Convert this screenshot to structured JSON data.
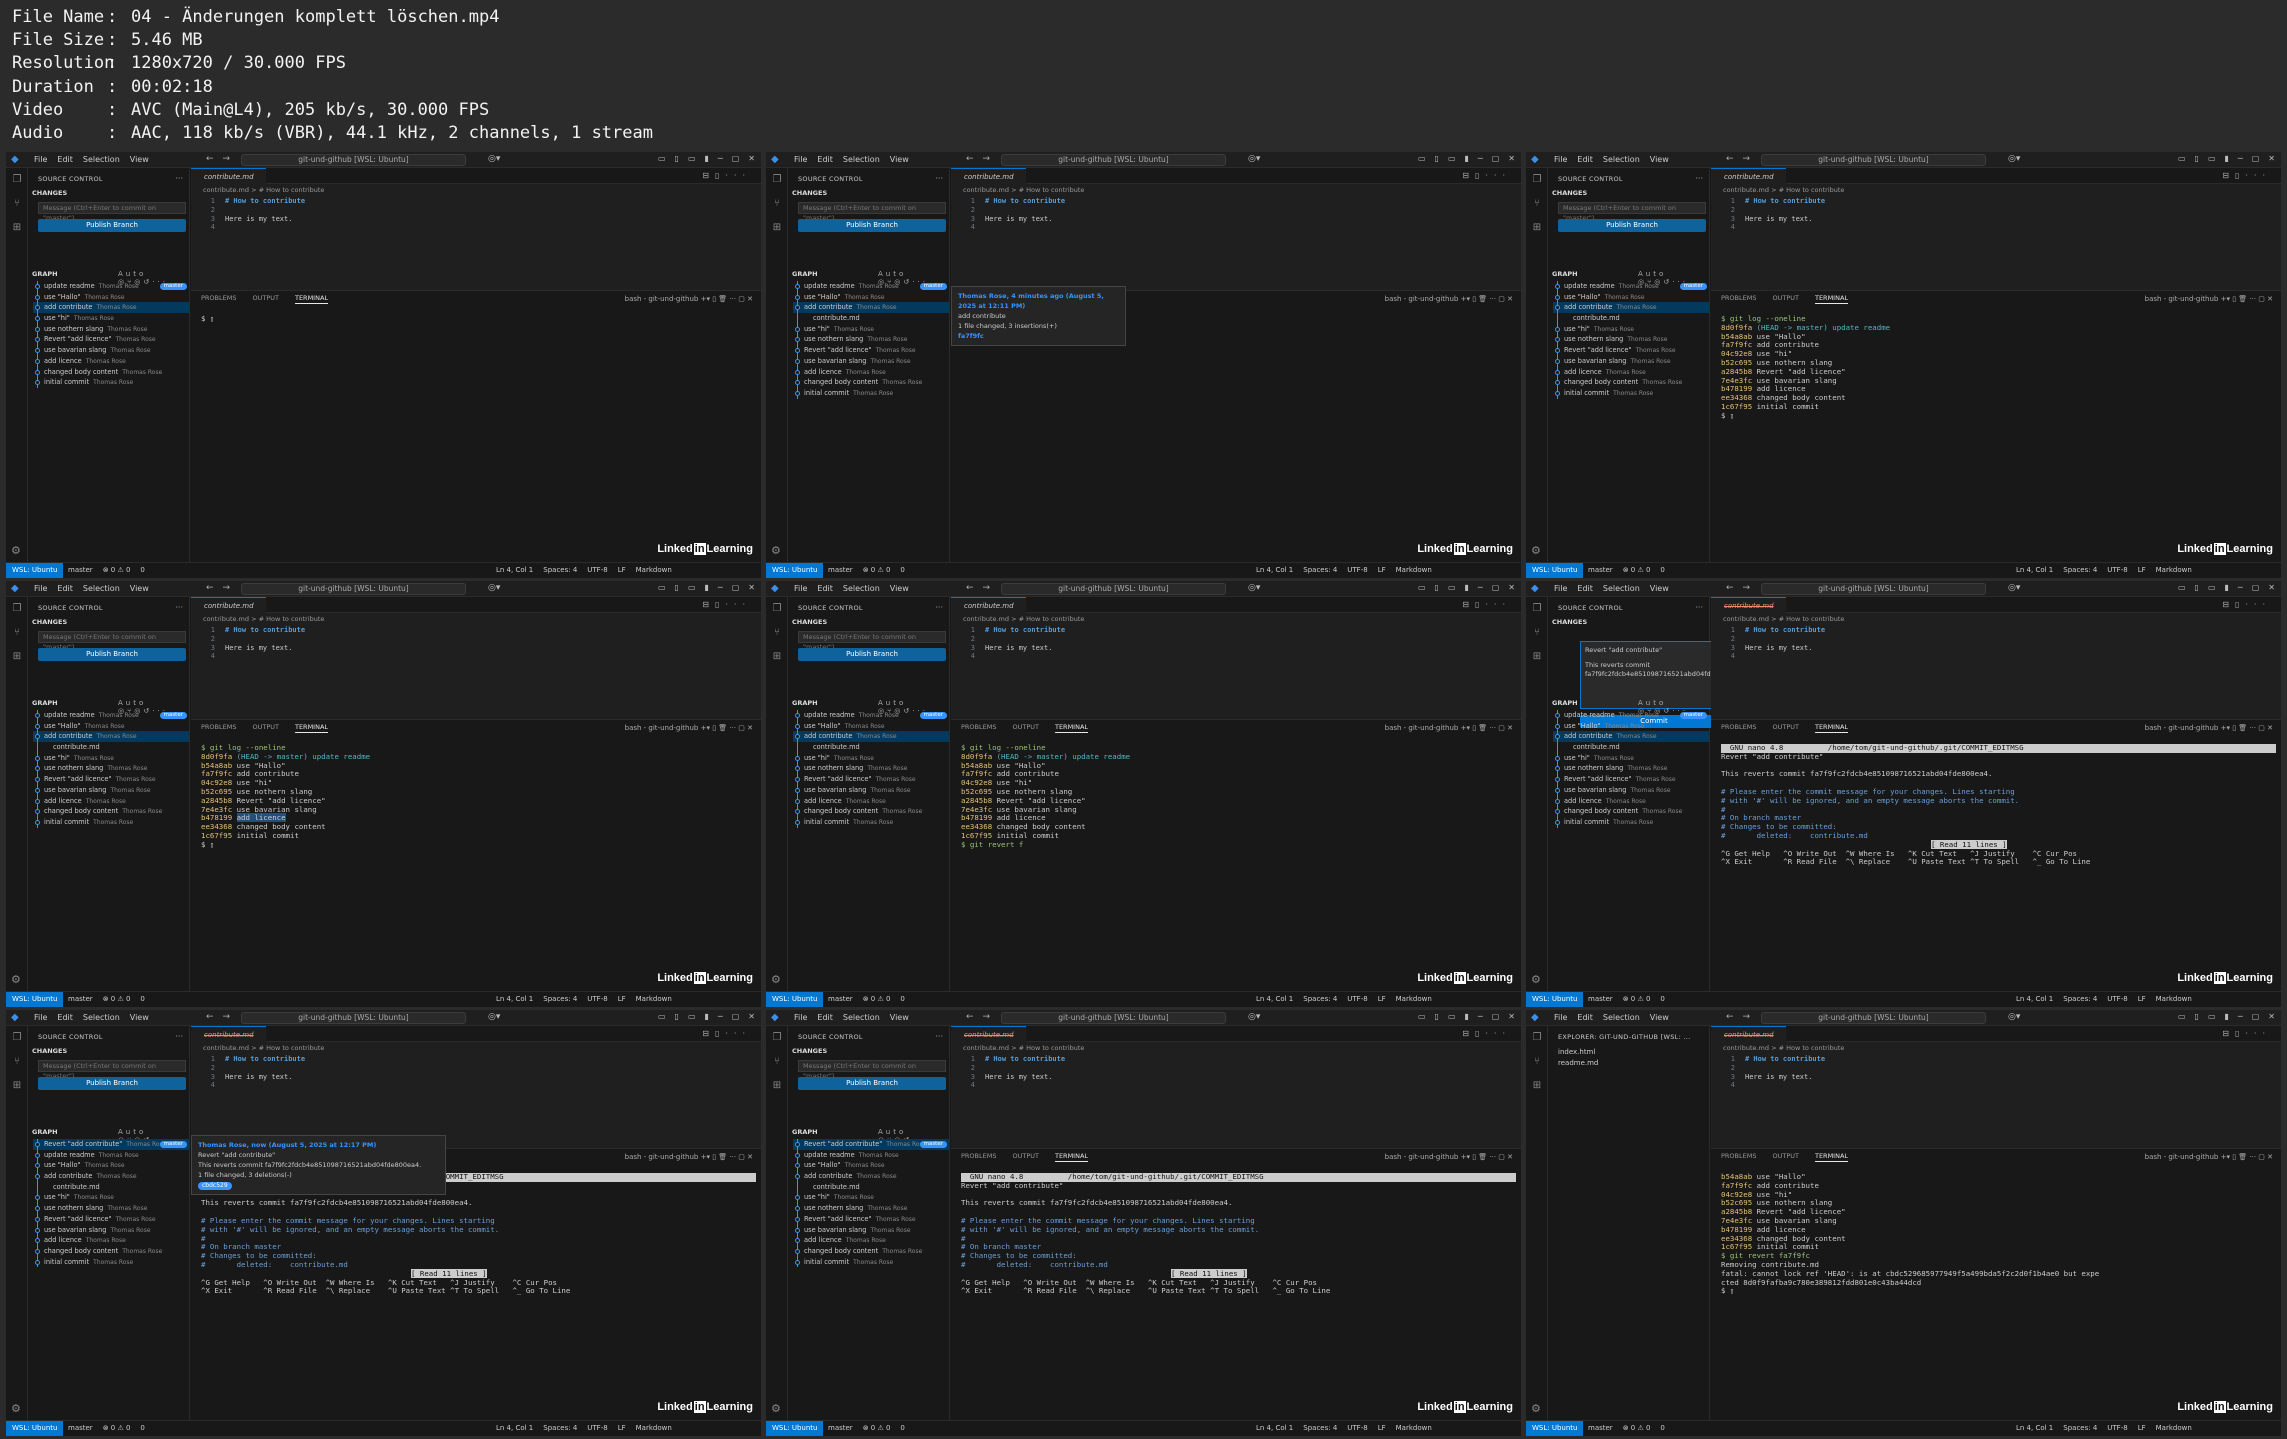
{
  "file_info": [
    {
      "key": "File Name",
      "value": "04 - Änderungen komplett löschen.mp4"
    },
    {
      "key": "File Size",
      "value": "5.46 MB"
    },
    {
      "key": "Resolution",
      "value": "1280x720 / 30.000 FPS"
    },
    {
      "key": "Duration",
      "value": "00:02:18"
    },
    {
      "key": "Video",
      "value": "AVC (Main@L4), 205 kb/s, 30.000 FPS"
    },
    {
      "key": "Audio",
      "value": "AAC, 118 kb/s (VBR), 44.1 kHz, 2 channels, 1 stream"
    }
  ],
  "window": {
    "menu": [
      "File",
      "Edit",
      "Selection",
      "View"
    ],
    "search": "git-und-github [WSL: Ubuntu]"
  },
  "sidebar": {
    "title": "SOURCE CONTROL",
    "changes": "CHANGES",
    "message_placeholder": "Message (Ctrl+Enter to commit on \"master\")",
    "publish": "Publish Branch",
    "graph": "GRAPH",
    "graph_auto": "Auto",
    "author": "Thomas Rose",
    "branch_badge": "master",
    "commits": [
      "update readme",
      "use \"Hallo\"",
      "add contribute",
      "use \"hi\"",
      "use nothern slang",
      "Revert \"add licence\"",
      "use bavarian slang",
      "add licence",
      "changed body content",
      "initial commit"
    ],
    "file_child": "contribute.md",
    "revert_commit": "Revert \"add contribute\"",
    "explorer_title": "EXPLORER: GIT-UND-GITHUB [WSL: ...",
    "explorer_files": [
      "index.html",
      "readme.md"
    ]
  },
  "editor": {
    "tab": "contribute.md",
    "breadcrumb": "contribute.md > # How to contribute",
    "lines": [
      {
        "n": "1",
        "t": "# How to contribute",
        "h": true
      },
      {
        "n": "2",
        "t": "",
        "h": false
      },
      {
        "n": "3",
        "t": "Here is my text.",
        "h": false
      },
      {
        "n": "4",
        "t": "",
        "h": false
      }
    ]
  },
  "terminal": {
    "tabs": [
      "PROBLEMS",
      "OUTPUT",
      "TERMINAL"
    ],
    "shell": "bash - git-und-github",
    "log_cmd": "$ git log --oneline",
    "log": [
      {
        "h": "8d0f9fa",
        "m": "(HEAD -> master) update readme"
      },
      {
        "h": "b54a8ab",
        "m": "use \"Hallo\""
      },
      {
        "h": "fa7f9fc",
        "m": "add contribute"
      },
      {
        "h": "04c92e8",
        "m": "use \"hi\""
      },
      {
        "h": "b52c695",
        "m": "use nothern slang"
      },
      {
        "h": "a2845b8",
        "m": "Revert \"add licence\""
      },
      {
        "h": "7e4e3fc",
        "m": "use bavarian slang"
      },
      {
        "h": "b478199",
        "m": "add licence"
      },
      {
        "h": "ee34368",
        "m": "changed body content"
      },
      {
        "h": "1c67f95",
        "m": "initial commit"
      }
    ],
    "revert_partial": "$ git revert f",
    "nano_header": "  GNU nano 4.8          /home/tom/git-und-github/.git/COMMIT_EDITMSG",
    "nano_title": "Revert \"add contribute\"",
    "nano_reverts": "This reverts commit fa7f9fc2fdcb4e851098716521abd04fde800ea4.",
    "nano_comment1": "# Please enter the commit message for your changes. Lines starting",
    "nano_comment2": "# with '#' will be ignored, and an empty message aborts the commit.",
    "nano_comment3": "#",
    "nano_comment4": "# On branch master",
    "nano_comment5": "# Changes to be committed:",
    "nano_comment6": "#       deleted:    contribute.md",
    "nano_read": "[ Read 11 lines ]",
    "nano_keys1": "^G Get Help   ^O Write Out  ^W Where Is   ^K Cut Text   ^J Justify    ^C Cur Pos",
    "nano_keys2": "^X Exit       ^R Read File  ^\\ Replace    ^U Paste Text ^T To Spell   ^_ Go To Line",
    "final_cmd": "$ git revert fa7f9fc",
    "final_remove": "Removing contribute.md",
    "final_error1": "fatal: cannot lock ref 'HEAD': is at cbdc529685977949f5a499bda5f2c2d0f1b4ae0 but expe",
    "final_error2": "cted 8d0f9fafba9c780e389812fdd801e0c43ba44dcd"
  },
  "hovers": {
    "first_head": "Thomas Rose, 4 minutes ago (August 5, 2025 at 12:11 PM)",
    "first_body": "add contribute",
    "first_stats": "1 file changed, 3 insertions(+)",
    "first_hash": "fa7f9fc",
    "second_head": "Thomas Rose, now (August 5, 2025 at 12:17 PM)",
    "second_title": "Revert \"add contribute\"",
    "second_body": "This reverts commit fa7f9fc2fdcb4e851098716521abd04fde800ea4.",
    "second_stats": "1 file changed, 3 deletions(-)",
    "second_hash": "cbdc529"
  },
  "commit_box": {
    "title": "Revert \"add contribute\"",
    "body": "This reverts commit fa7f9fc2fdcb4e851098716521abd04fde800ea4.",
    "button": "Commit"
  },
  "status": {
    "remote": "WSL: Ubuntu",
    "branch": "master",
    "problems": "⊗ 0 ⚠ 0",
    "ports": "0",
    "position": "Ln 4, Col 1",
    "spaces": "Spaces: 4",
    "encoding": "UTF-8",
    "eol": "LF",
    "lang": "Markdown"
  },
  "brand": {
    "linked": "Linked",
    "in": "in",
    "learning": "Learning"
  },
  "colors": {
    "accent": "#0078d4",
    "branch": "#3794ff",
    "background": "#181818"
  }
}
